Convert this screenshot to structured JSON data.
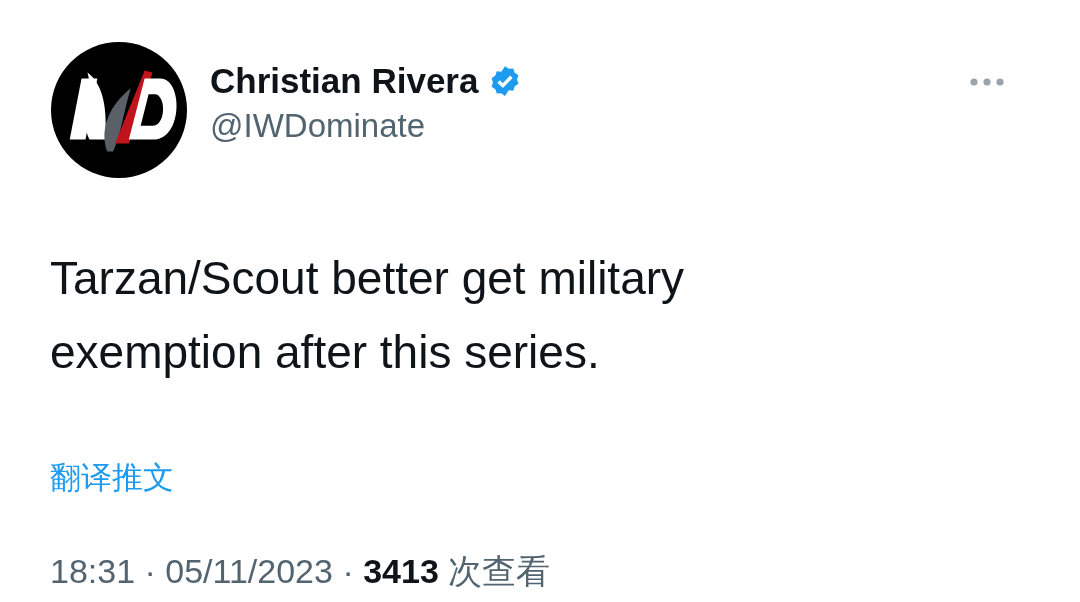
{
  "author": {
    "name": "Christian Rivera",
    "verified": true,
    "handle": "@IWDominate"
  },
  "tweet": {
    "text": "Tarzan/Scout better get military exemption after this series.",
    "translate_link": "翻译推文",
    "meta": "18:31 · 05/11/2023 · **3413** 次查看"
  }
}
